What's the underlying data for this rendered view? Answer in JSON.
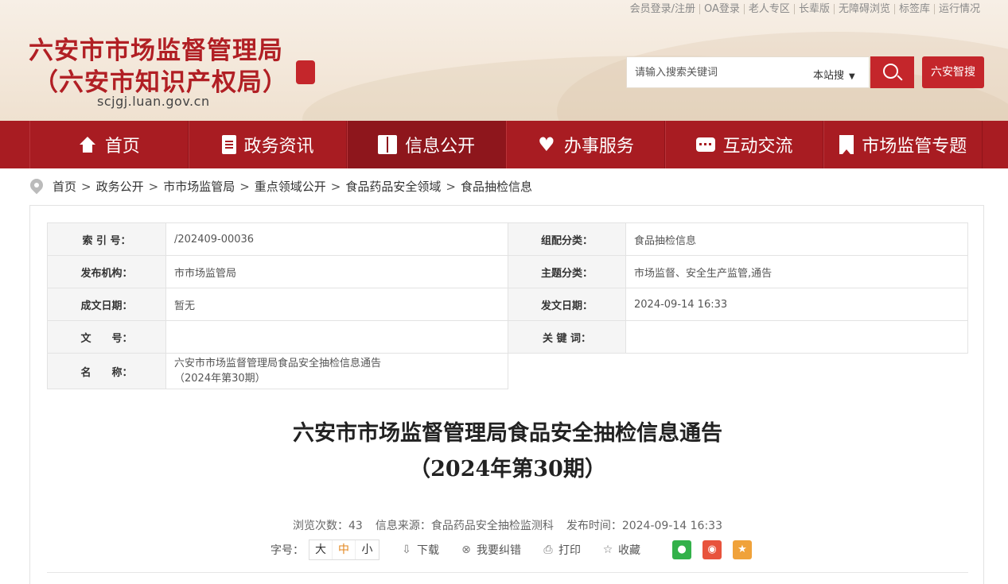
{
  "header": {
    "top_links": [
      "会员登录/注册",
      "OA登录",
      "老人专区",
      "长辈版",
      "无障碍浏览",
      "标签库",
      "运行情况"
    ],
    "org_name_line1": "六安市市场监督管理局",
    "org_name_line2": "（六安市知识产权局）",
    "domain": "scjgj.luan.gov.cn",
    "search_placeholder": "请输入搜索关键词",
    "search_scope": "本站搜",
    "smart_search_label": "六安智搜"
  },
  "nav": {
    "items": [
      {
        "label": "首页",
        "icon": "home-icon"
      },
      {
        "label": "政务资讯",
        "icon": "document-icon"
      },
      {
        "label": "信息公开",
        "icon": "book-icon",
        "active": true
      },
      {
        "label": "办事服务",
        "icon": "heart-icon"
      },
      {
        "label": "互动交流",
        "icon": "chat-icon"
      },
      {
        "label": "市场监管专题",
        "icon": "bookmark-icon"
      }
    ]
  },
  "breadcrumb": [
    "首页",
    "政务公开",
    "市市场监管局",
    "重点领域公开",
    "食品药品安全领域",
    "食品抽检信息"
  ],
  "meta": {
    "index_label": "索 引 号：",
    "index_value": "/202409-00036",
    "category_label": "组配分类：",
    "category_value": "食品抽检信息",
    "publisher_label": "发布机构：",
    "publisher_value": "市市场监管局",
    "topic_label": "主题分类：",
    "topic_value": "市场监督、安全生产监管,通告",
    "created_label": "成文日期：",
    "created_value": "暂无",
    "issued_label": "发文日期：",
    "issued_value": "2024-09-14 16:33",
    "docno_label": "文　　号：",
    "docno_value": "",
    "keywords_label": "关 键 词：",
    "keywords_value": "",
    "name_label": "名　　称：",
    "name_value_line1": "六安市市场监督管理局食品安全抽检信息通告",
    "name_value_line2": "（2024年第30期）"
  },
  "article": {
    "title_line1": "六安市市场监督管理局食品安全抽检信息通告",
    "title_line2": "（2024年第30期）",
    "views": "浏览次数：43",
    "source": "信息来源：食品药品安全抽检监测科",
    "publish_time": "发布时间：2024-09-14 16:33"
  },
  "tools": {
    "font_size_label": "字号：",
    "sizes": [
      "大",
      "中",
      "小"
    ],
    "download": "下载",
    "report_error": "我要纠错",
    "print": "打印",
    "favorite": "收藏"
  },
  "colors": {
    "brand_red": "#a81c22",
    "active_nav": "#8e161c",
    "accent_orange": "#e3861c"
  }
}
